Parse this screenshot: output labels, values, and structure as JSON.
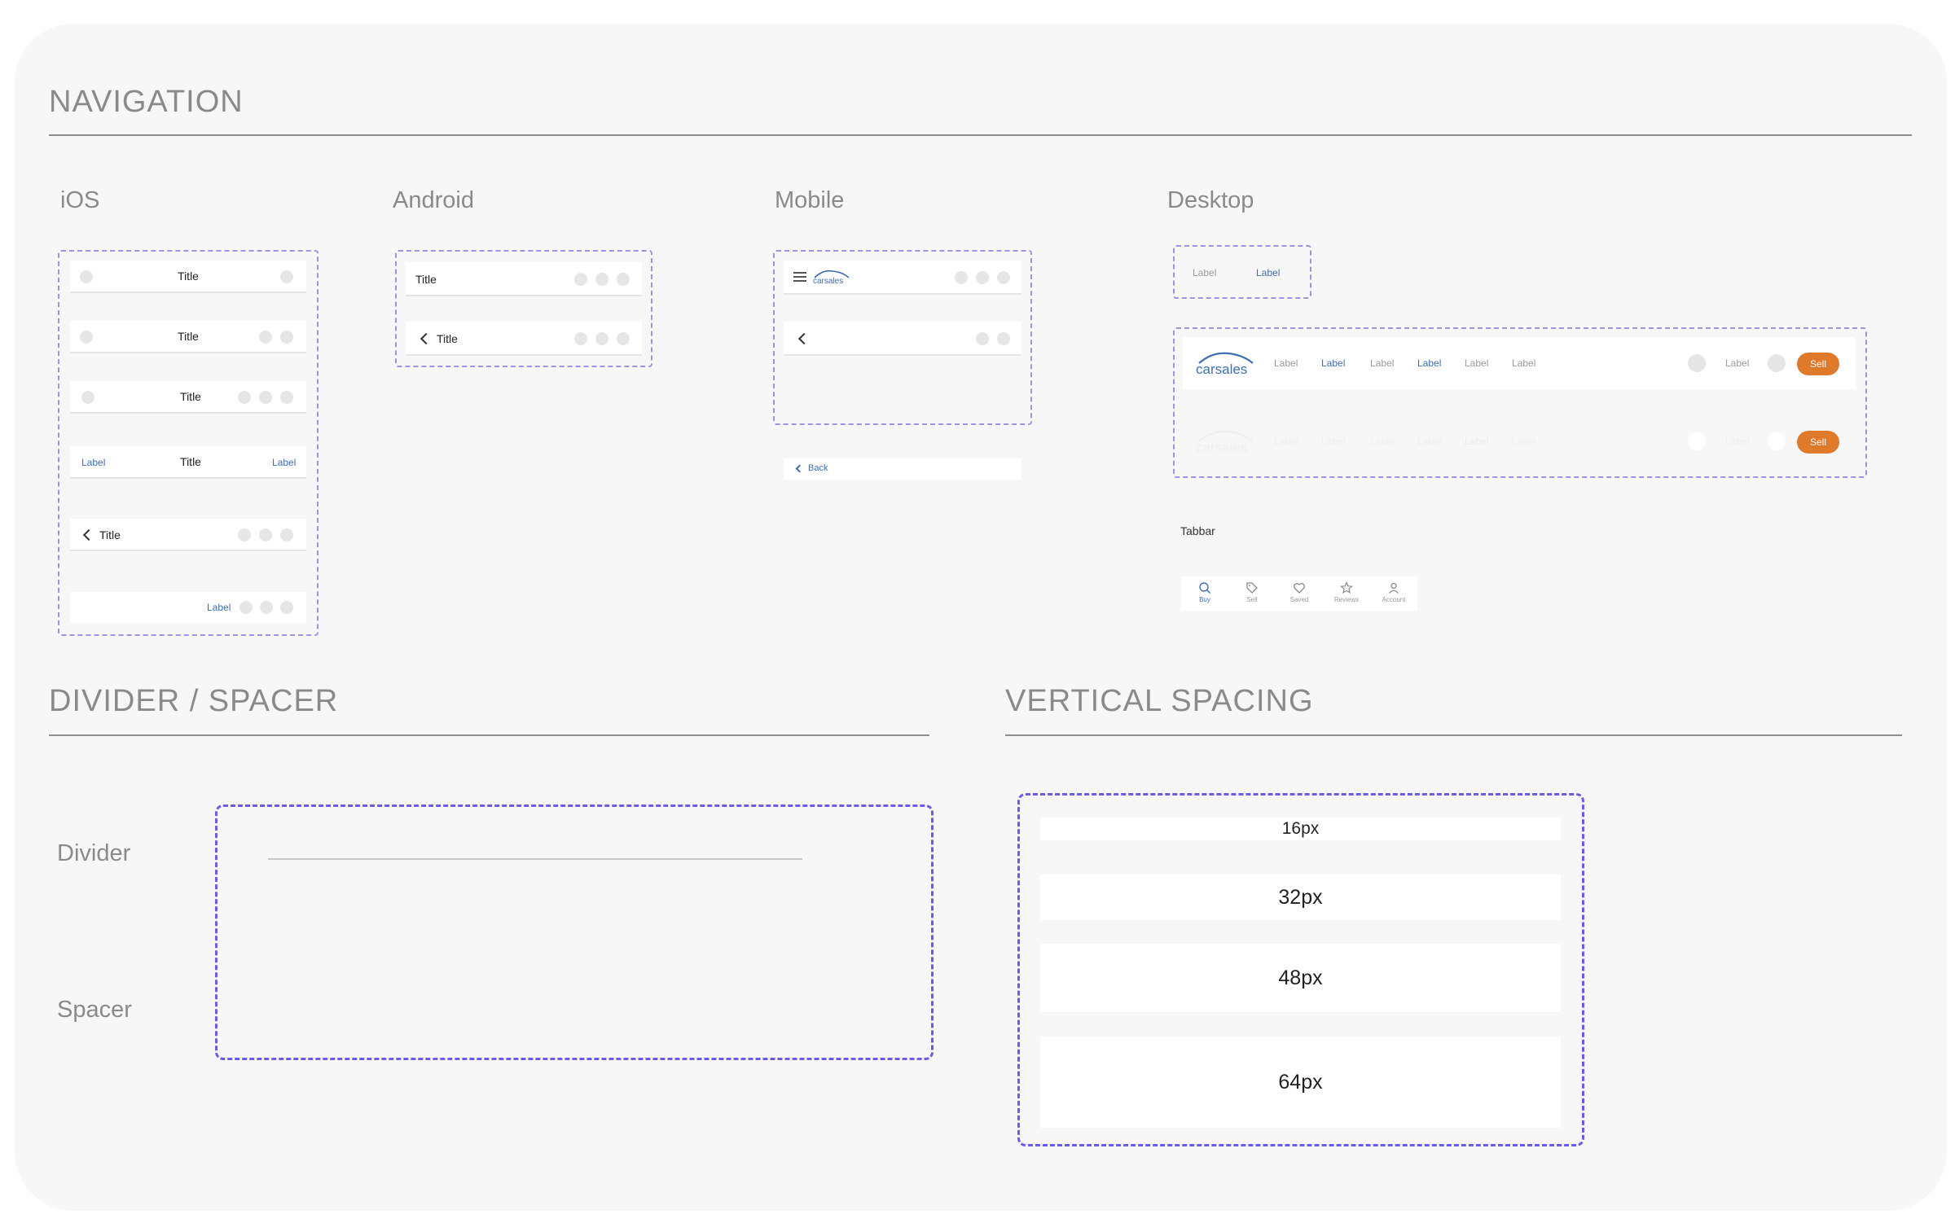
{
  "sections": {
    "navigation": "NAVIGATION",
    "divider_spacer": "DIVIDER / SPACER",
    "vertical_spacing": "VERTICAL SPACING"
  },
  "platforms": {
    "ios": "iOS",
    "android": "Android",
    "mobile": "Mobile",
    "desktop": "Desktop"
  },
  "ios": {
    "title": "Title",
    "label": "Label"
  },
  "android": {
    "title": "Title"
  },
  "mobile": {
    "back": "Back"
  },
  "desktop": {
    "label": "Label",
    "sell": "Sell",
    "tabbar_label": "Tabbar",
    "tabs": [
      "Buy",
      "Sell",
      "Saved",
      "Reviews",
      "Account"
    ]
  },
  "divider_spacer": {
    "divider": "Divider",
    "spacer": "Spacer"
  },
  "spacing": [
    "16px",
    "32px",
    "48px",
    "64px"
  ],
  "colors": {
    "accent_blue": "#3f6fb3",
    "sell_orange": "#e07a2b",
    "dashed_outline": "#6a5ce8"
  }
}
